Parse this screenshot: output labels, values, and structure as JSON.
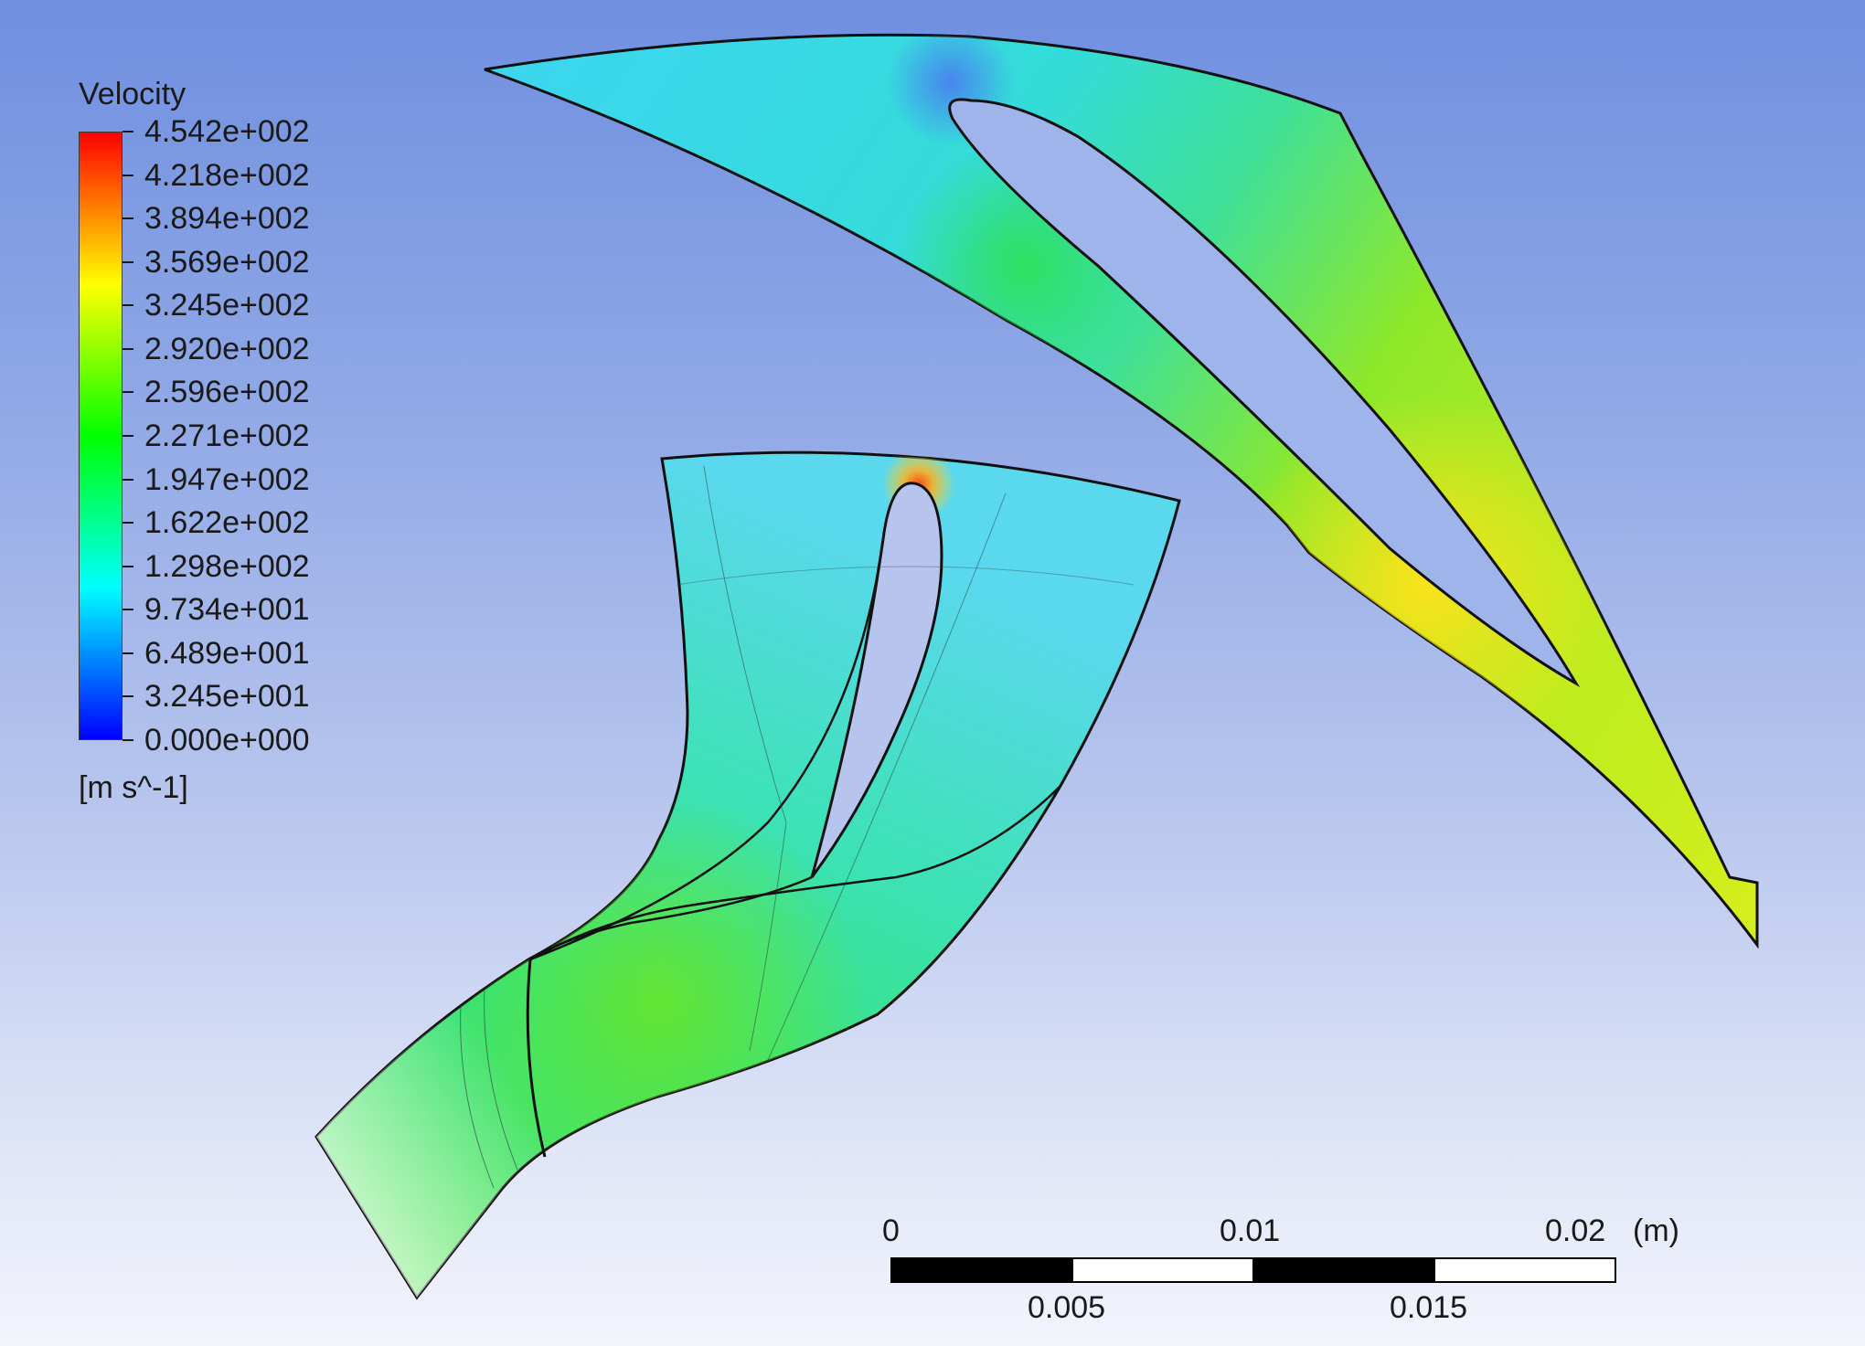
{
  "legend": {
    "title": "Velocity",
    "ticks": [
      "4.542e+002",
      "4.218e+002",
      "3.894e+002",
      "3.569e+002",
      "3.245e+002",
      "2.920e+002",
      "2.596e+002",
      "2.271e+002",
      "1.947e+002",
      "1.622e+002",
      "1.298e+002",
      "9.734e+001",
      "6.489e+001",
      "3.245e+001",
      "0.000e+000"
    ],
    "units": "[m s^-1]",
    "colormap": [
      "#ff0000",
      "#ff8000",
      "#ffff00",
      "#80ff00",
      "#00ff00",
      "#00ff80",
      "#00ffff",
      "#0080ff",
      "#0000ff"
    ]
  },
  "scale_bar": {
    "top_labels": [
      "0",
      "0.01",
      "0.02"
    ],
    "bottom_labels": [
      "0.005",
      "0.015"
    ],
    "unit": "(m)"
  },
  "colors": {
    "background_top": "#6f8fe0",
    "background_bottom": "#f3f5fc",
    "low_velocity": "#3cd6f0",
    "mid_velocity": "#4ee870",
    "high_velocity": "#f6ec1a",
    "peak_velocity": "#ff4a10"
  }
}
